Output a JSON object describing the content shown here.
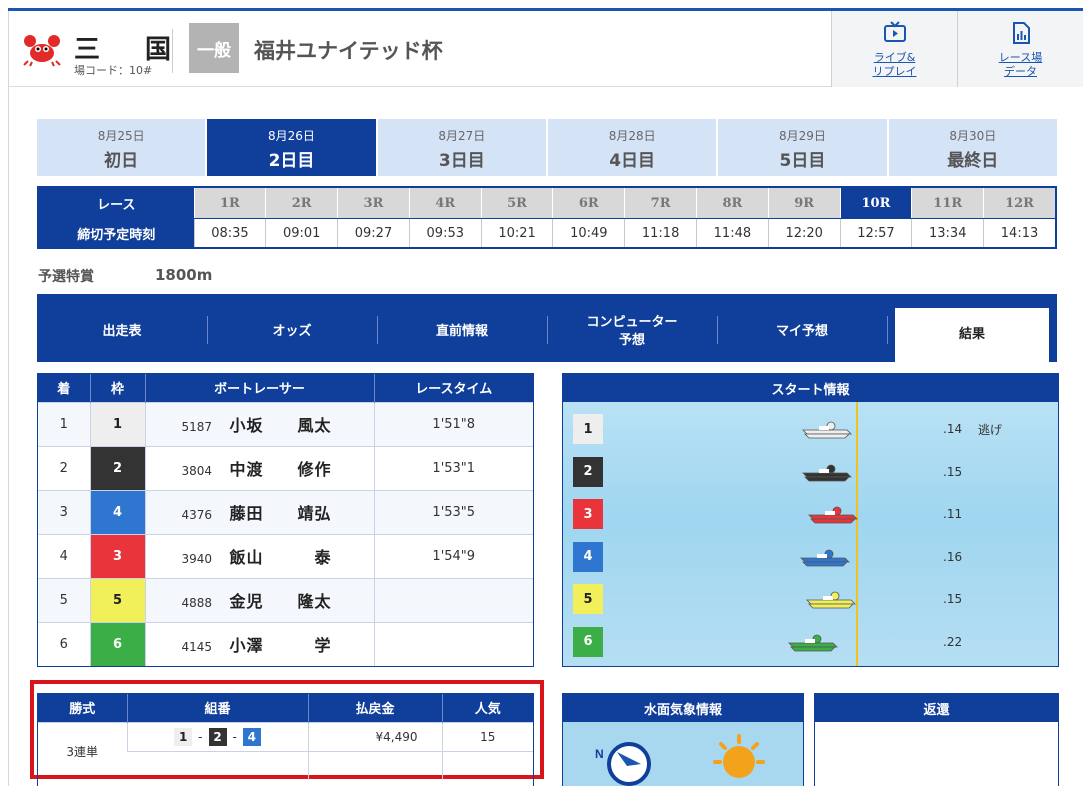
{
  "header": {
    "venue": "三 国",
    "venue_code": "場コード：10#",
    "grade": "一般",
    "title": "福井ユナイテッド杯",
    "buttons": [
      {
        "label_line1": "ライブ&",
        "label_line2": "リプレイ",
        "icon": "tv-icon"
      },
      {
        "label_line1": "レース場",
        "label_line2": "データ",
        "icon": "data-file-icon"
      }
    ]
  },
  "days": [
    {
      "date": "8月25日",
      "label": "初日"
    },
    {
      "date": "8月26日",
      "label": "2日目"
    },
    {
      "date": "8月27日",
      "label": "3日目"
    },
    {
      "date": "8月28日",
      "label": "4日目"
    },
    {
      "date": "8月29日",
      "label": "5日目"
    },
    {
      "date": "8月30日",
      "label": "最終日"
    }
  ],
  "active_day": "8月26日",
  "races": {
    "head_race": "レース",
    "head_time": "締切予定時刻",
    "labels": [
      "1R",
      "2R",
      "3R",
      "4R",
      "5R",
      "6R",
      "7R",
      "8R",
      "9R",
      "10R",
      "11R",
      "12R"
    ],
    "times": [
      "08:35",
      "09:01",
      "09:27",
      "09:53",
      "10:21",
      "10:49",
      "11:18",
      "11:48",
      "12:20",
      "12:57",
      "13:34",
      "14:13"
    ],
    "current": "10R"
  },
  "race_info": {
    "name": "予選特賞",
    "distance": "1800m"
  },
  "nav": {
    "items": [
      "出走表",
      "オッズ",
      "直前情報",
      "コンピューター",
      "マイ予想",
      "結果"
    ],
    "item4_line2": "予想",
    "active": "結果"
  },
  "results": {
    "headers": [
      "着",
      "枠",
      "ボートレーサー",
      "レースタイム"
    ],
    "rows": [
      {
        "place": "1",
        "frame": "1",
        "reg": "5187",
        "name": "小坂　　風太",
        "time": "1'51\"8"
      },
      {
        "place": "2",
        "frame": "2",
        "reg": "3804",
        "name": "中渡　　修作",
        "time": "1'53\"1"
      },
      {
        "place": "3",
        "frame": "4",
        "reg": "4376",
        "name": "藤田　　靖弘",
        "time": "1'53\"5"
      },
      {
        "place": "4",
        "frame": "3",
        "reg": "3940",
        "name": "飯山　　　泰",
        "time": "1'54\"9"
      },
      {
        "place": "5",
        "frame": "5",
        "reg": "4888",
        "name": "金児　　隆太",
        "time": ""
      },
      {
        "place": "6",
        "frame": "6",
        "reg": "4145",
        "name": "小澤　　　学",
        "time": ""
      }
    ]
  },
  "start_info": {
    "title": "スタート情報",
    "rows": [
      {
        "boat": "1",
        "st": ".14",
        "note": "逃げ"
      },
      {
        "boat": "2",
        "st": ".15",
        "note": ""
      },
      {
        "boat": "3",
        "st": ".11",
        "note": ""
      },
      {
        "boat": "4",
        "st": ".16",
        "note": ""
      },
      {
        "boat": "5",
        "st": ".15",
        "note": ""
      },
      {
        "boat": "6",
        "st": ".22",
        "note": ""
      }
    ]
  },
  "payout": {
    "headers": [
      "勝式",
      "組番",
      "払戻金",
      "人気"
    ],
    "type": "3連単",
    "combo": [
      "1",
      "2",
      "4"
    ],
    "sep": "-",
    "amount": "¥4,490",
    "popularity": "15"
  },
  "weather": {
    "title": "水面気象情報",
    "compass_label": "N"
  },
  "refund": {
    "title": "返還"
  },
  "colors": {
    "primary": "#0f3e9b",
    "boat1": "#eeeeee",
    "boat2": "#333333",
    "boat3": "#e8343a",
    "boat4": "#2e76cf",
    "boat5": "#f2f05a",
    "boat6": "#3bae47",
    "highlight": "#d9141b"
  }
}
